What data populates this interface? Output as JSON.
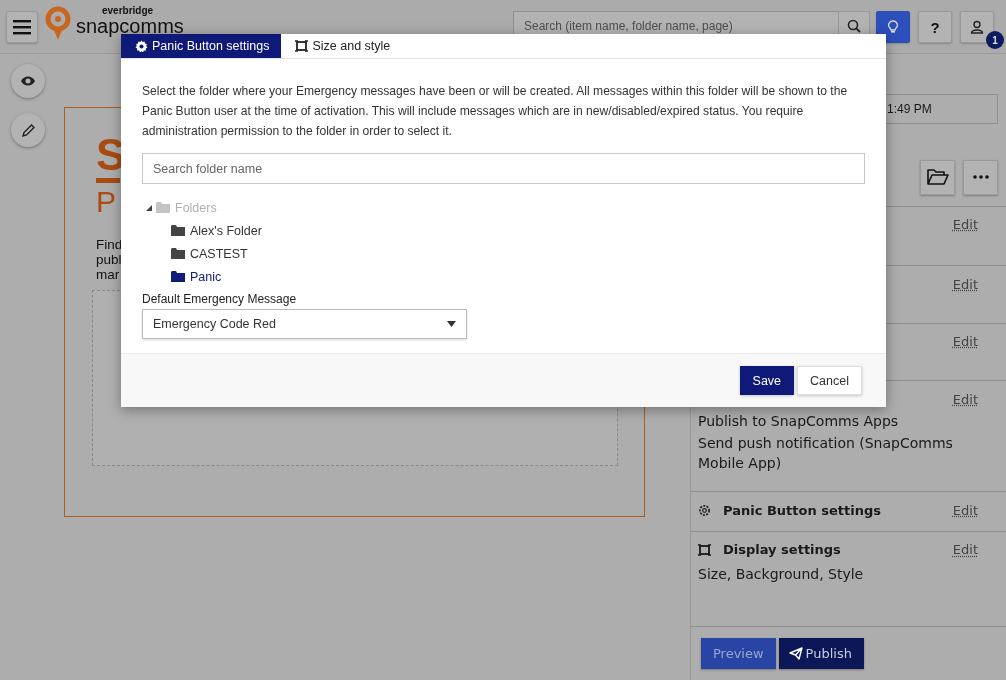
{
  "header": {
    "logo_small": "everbridge",
    "logo_main": "snapcomms",
    "search": {
      "placeholder": "Search (item name, folder name, page)"
    },
    "help_label": "?",
    "notification_count": "1"
  },
  "preview_card": {
    "logo_letter": "S",
    "title": "P",
    "lines": [
      "Find",
      "publ",
      "mar"
    ]
  },
  "right_panel": {
    "datetime": "1:49 PM",
    "sections": [
      {
        "edit": "Edit"
      },
      {
        "edit": "Edit"
      },
      {
        "edit": "Edit"
      },
      {
        "edit": "Edit",
        "lines": [
          "Publish to SnapComms Apps",
          "Send push notification (SnapComms Mobile App)"
        ]
      },
      {
        "edit": "Edit",
        "kind": "settings",
        "title": "Panic Button settings"
      },
      {
        "edit": "Edit",
        "kind": "display",
        "title": "Display settings",
        "lines": [
          "Size, Background, Style"
        ]
      }
    ],
    "buttons": [
      {
        "label": "Preview",
        "kind": "secondary"
      },
      {
        "label": "Publish",
        "kind": "primary"
      }
    ]
  },
  "dialog": {
    "tabs": [
      {
        "label": "Panic Button settings",
        "kind": "settings",
        "selected": true
      },
      {
        "label": "Size and style",
        "kind": "display",
        "selected": false
      }
    ],
    "description": "Select the folder where your Emergency messages have been or will be created. All messages within this folder will be shown to the Panic Button user at the time of activation. This will include messages which are in new/disabled/expired status. You require administration permission to the folder in order to select it.",
    "search": {
      "placeholder": "Search folder name"
    },
    "tree": {
      "label": "Folders",
      "expanded": true,
      "disabled": true,
      "children": [
        {
          "label": "Alex's Folder",
          "selected": false
        },
        {
          "label": "CASTEST",
          "selected": false
        },
        {
          "label": "Panic",
          "selected": true
        }
      ]
    },
    "select_label": "Default Emergency Message",
    "select_value": "Emergency Code Red",
    "buttons": [
      {
        "label": "Save",
        "kind": "primary"
      },
      {
        "label": "Cancel",
        "kind": "secondary"
      }
    ]
  }
}
